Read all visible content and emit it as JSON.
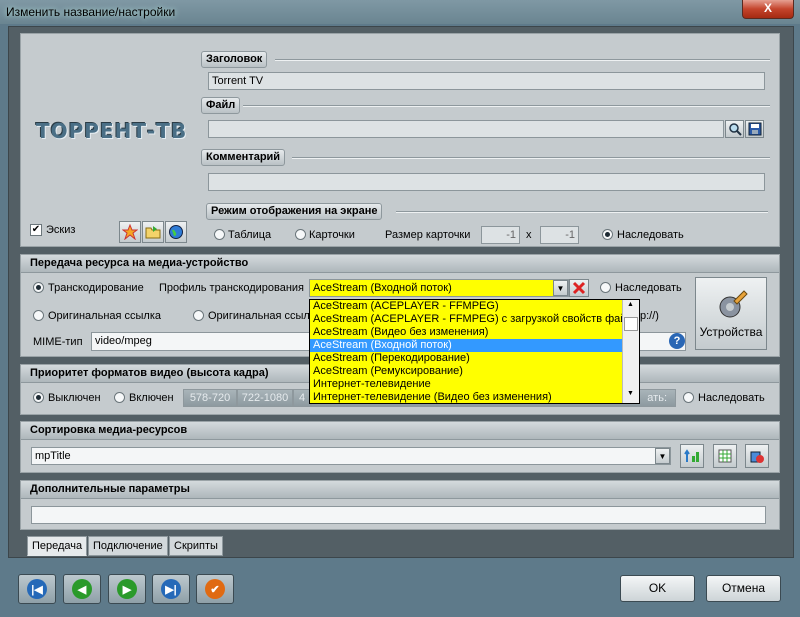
{
  "window": {
    "title": "Изменить название/настройки",
    "close_label": "X"
  },
  "logo_text": "ТОРРЕНТ-ТВ",
  "title_group": {
    "label": "Заголовок",
    "value": "Torrent TV"
  },
  "file_group": {
    "label": "Файл",
    "value": ""
  },
  "comment_group": {
    "label": "Комментарий",
    "value": ""
  },
  "sketch": {
    "label": "Эскиз",
    "checked": true
  },
  "display_mode": {
    "label": "Режим отображения на экране",
    "table": "Таблица",
    "cards": "Карточки",
    "card_size_label": "Размер карточки",
    "card_w": "-1",
    "x": "x",
    "card_h": "-1",
    "inherit": "Наследовать"
  },
  "transfer": {
    "header": "Передача ресурса на медиа-устройство",
    "transcoding": "Транскодирование",
    "profile_label": "Профиль транскодирования",
    "profile_value": "AceStream (Входной поток)",
    "inherit": "Наследовать",
    "original_link": "Оригинальная ссылка",
    "original_link2": "Оригинальная ссылк",
    "suffix": "p://)",
    "mime_label": "MIME-тип",
    "mime_value": "video/mpeg",
    "devices": "Устройства"
  },
  "dropdown_options": [
    "AceStream (ACEPLAYER - FFMPEG)",
    "AceStream (ACEPLAYER - FFMPEG) с загрузкой свойств файла",
    "AceStream (Видео без изменения)",
    "AceStream (Входной поток)",
    "AceStream (Перекодирование)",
    "AceStream (Ремуксирование)",
    "Интернет-телевидение",
    "Интернет-телевидение (Видео без изменения)"
  ],
  "video_priority": {
    "header": "Приоритет форматов видео (высота кадра)",
    "off": "Выключен",
    "on": "Включен",
    "res1": "578-720",
    "res2": "722-1080",
    "res3": "4",
    "tail": "ать:",
    "inherit": "Наследовать"
  },
  "sorting": {
    "header": "Сортировка медиа-ресурсов",
    "value": "mpTitle"
  },
  "extra": {
    "header": "Дополнительные параметры",
    "value": ""
  },
  "tabs": [
    "Передача",
    "Подключение",
    "Скрипты"
  ],
  "buttons": {
    "ok": "OK",
    "cancel": "Отмена"
  }
}
